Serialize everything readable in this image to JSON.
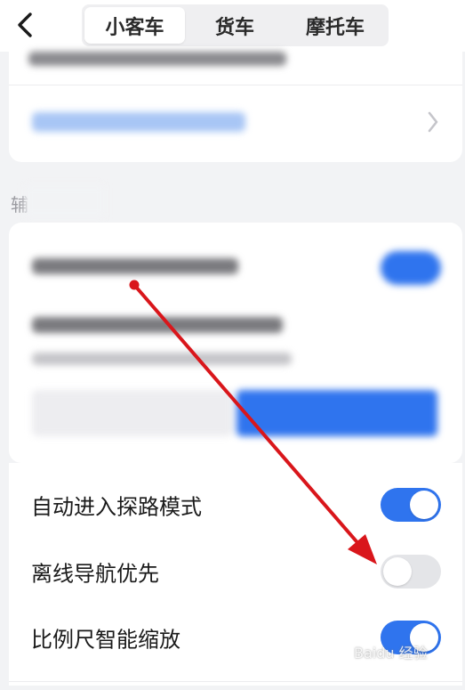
{
  "header": {
    "back_icon": "chevron-left-icon",
    "tabs": [
      {
        "label": "小客车",
        "active": true
      },
      {
        "label": "货车",
        "active": false
      },
      {
        "label": "摩托车",
        "active": false
      }
    ]
  },
  "section": {
    "label_partial": "辅"
  },
  "settings": [
    {
      "label": "自动进入探路模式",
      "enabled": true
    },
    {
      "label": "离线导航优先",
      "enabled": false
    },
    {
      "label": "比例尺智能缩放",
      "enabled": true
    }
  ],
  "colors": {
    "accent": "#2f74ee",
    "toggle_off": "#e4e5e8",
    "arrow": "#d9161b",
    "background": "#f2f3f5"
  },
  "watermark": {
    "text": "Baidu 经验"
  }
}
